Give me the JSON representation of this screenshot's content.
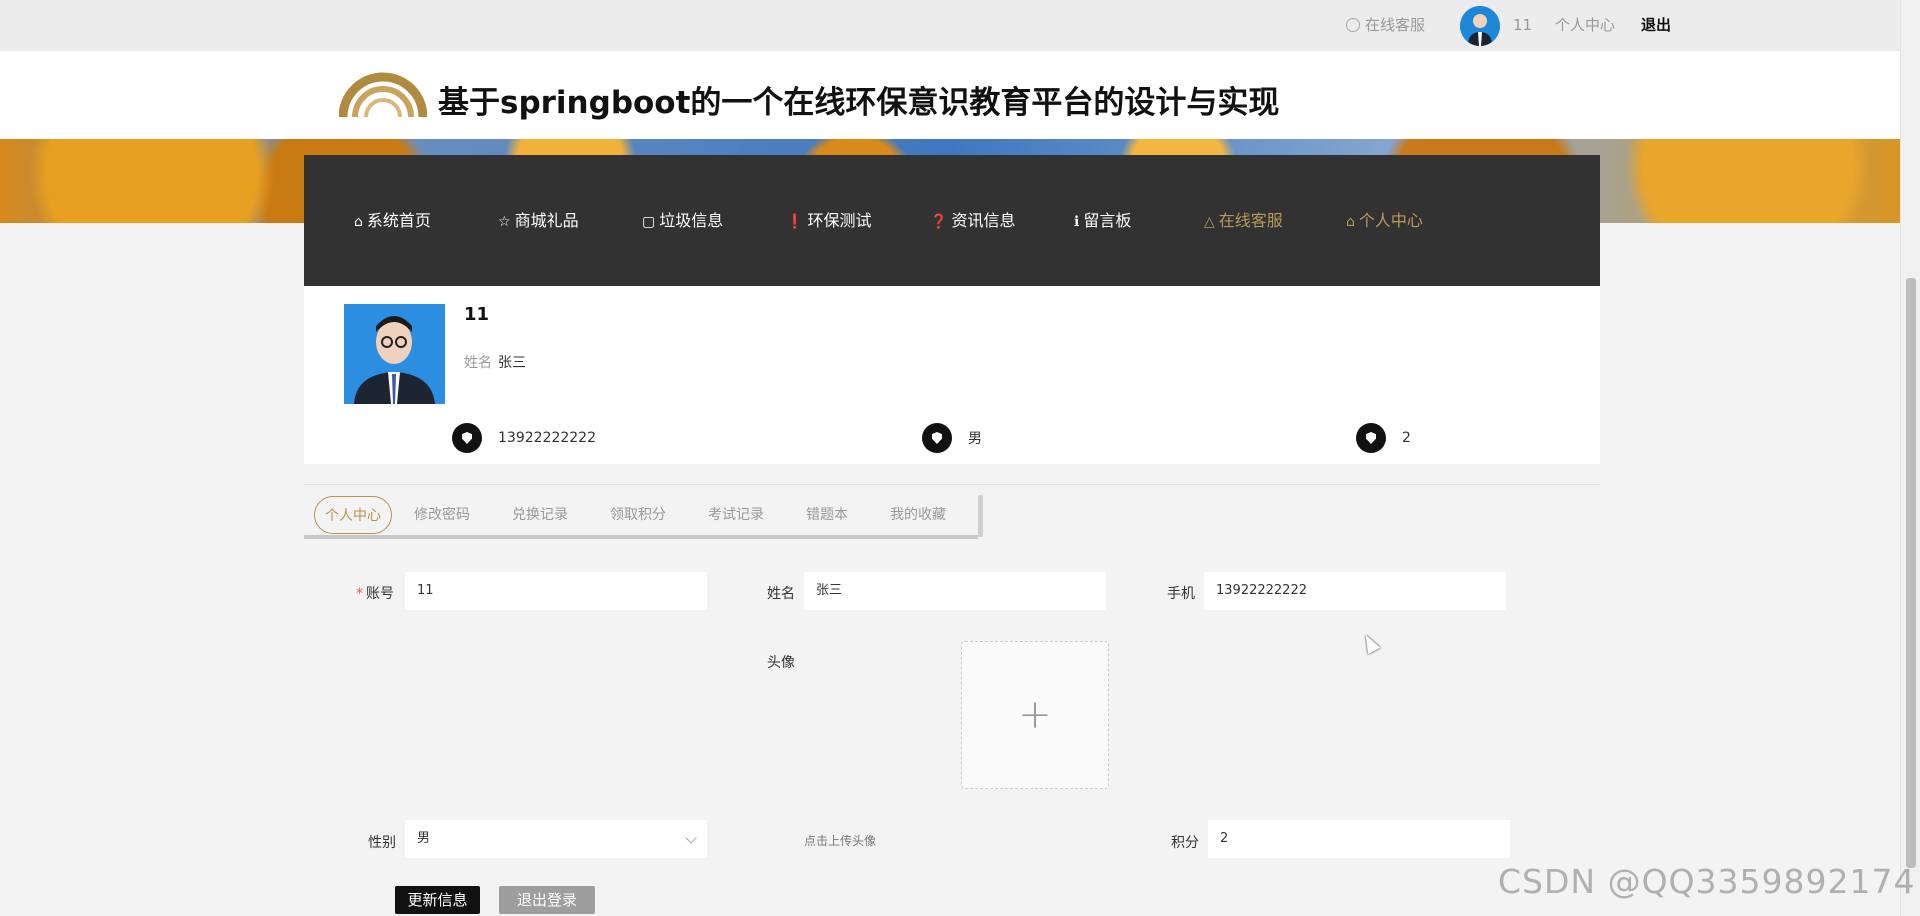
{
  "topbar": {
    "service_label": "在线客服",
    "username": "11",
    "personal_center": "个人中心",
    "logout": "退出"
  },
  "site": {
    "title": "基于springboot的一个在线环保意识教育平台的设计与实现"
  },
  "nav": {
    "items": [
      {
        "icon": "home-icon",
        "label": "系统首页"
      },
      {
        "icon": "star-icon",
        "label": "商城礼品"
      },
      {
        "icon": "bag-icon",
        "label": "垃圾信息"
      },
      {
        "icon": "exclamation-icon",
        "label": "环保测试"
      },
      {
        "icon": "question-icon",
        "label": "资讯信息"
      },
      {
        "icon": "info-icon",
        "label": "留言板"
      },
      {
        "icon": "bell-icon",
        "label": "在线客服"
      },
      {
        "icon": "home-icon",
        "label": "个人中心"
      }
    ]
  },
  "profile": {
    "username": "11",
    "name_label": "姓名",
    "name": "张三",
    "phone": "13922222222",
    "gender": "男",
    "points": "2"
  },
  "tabs": [
    "个人中心",
    "修改密码",
    "兑换记录",
    "领取积分",
    "考试记录",
    "错题本",
    "我的收藏"
  ],
  "form": {
    "account_label": "账号",
    "account_value": "11",
    "name_label": "姓名",
    "name_value": "张三",
    "phone_label": "手机",
    "phone_value": "13922222222",
    "avatar_label": "头像",
    "upload_hint": "点击上传头像",
    "gender_label": "性别",
    "gender_value": "男",
    "points_label": "积分",
    "points_value": "2",
    "update_button": "更新信息",
    "logout_button": "退出登录"
  },
  "watermark": "CSDN @QQ3359892174",
  "colors": {
    "nav_bg": "#323232",
    "gold_accent": "#b89a5b",
    "primary_button": "#111111",
    "secondary_button": "#9e9e9e"
  }
}
